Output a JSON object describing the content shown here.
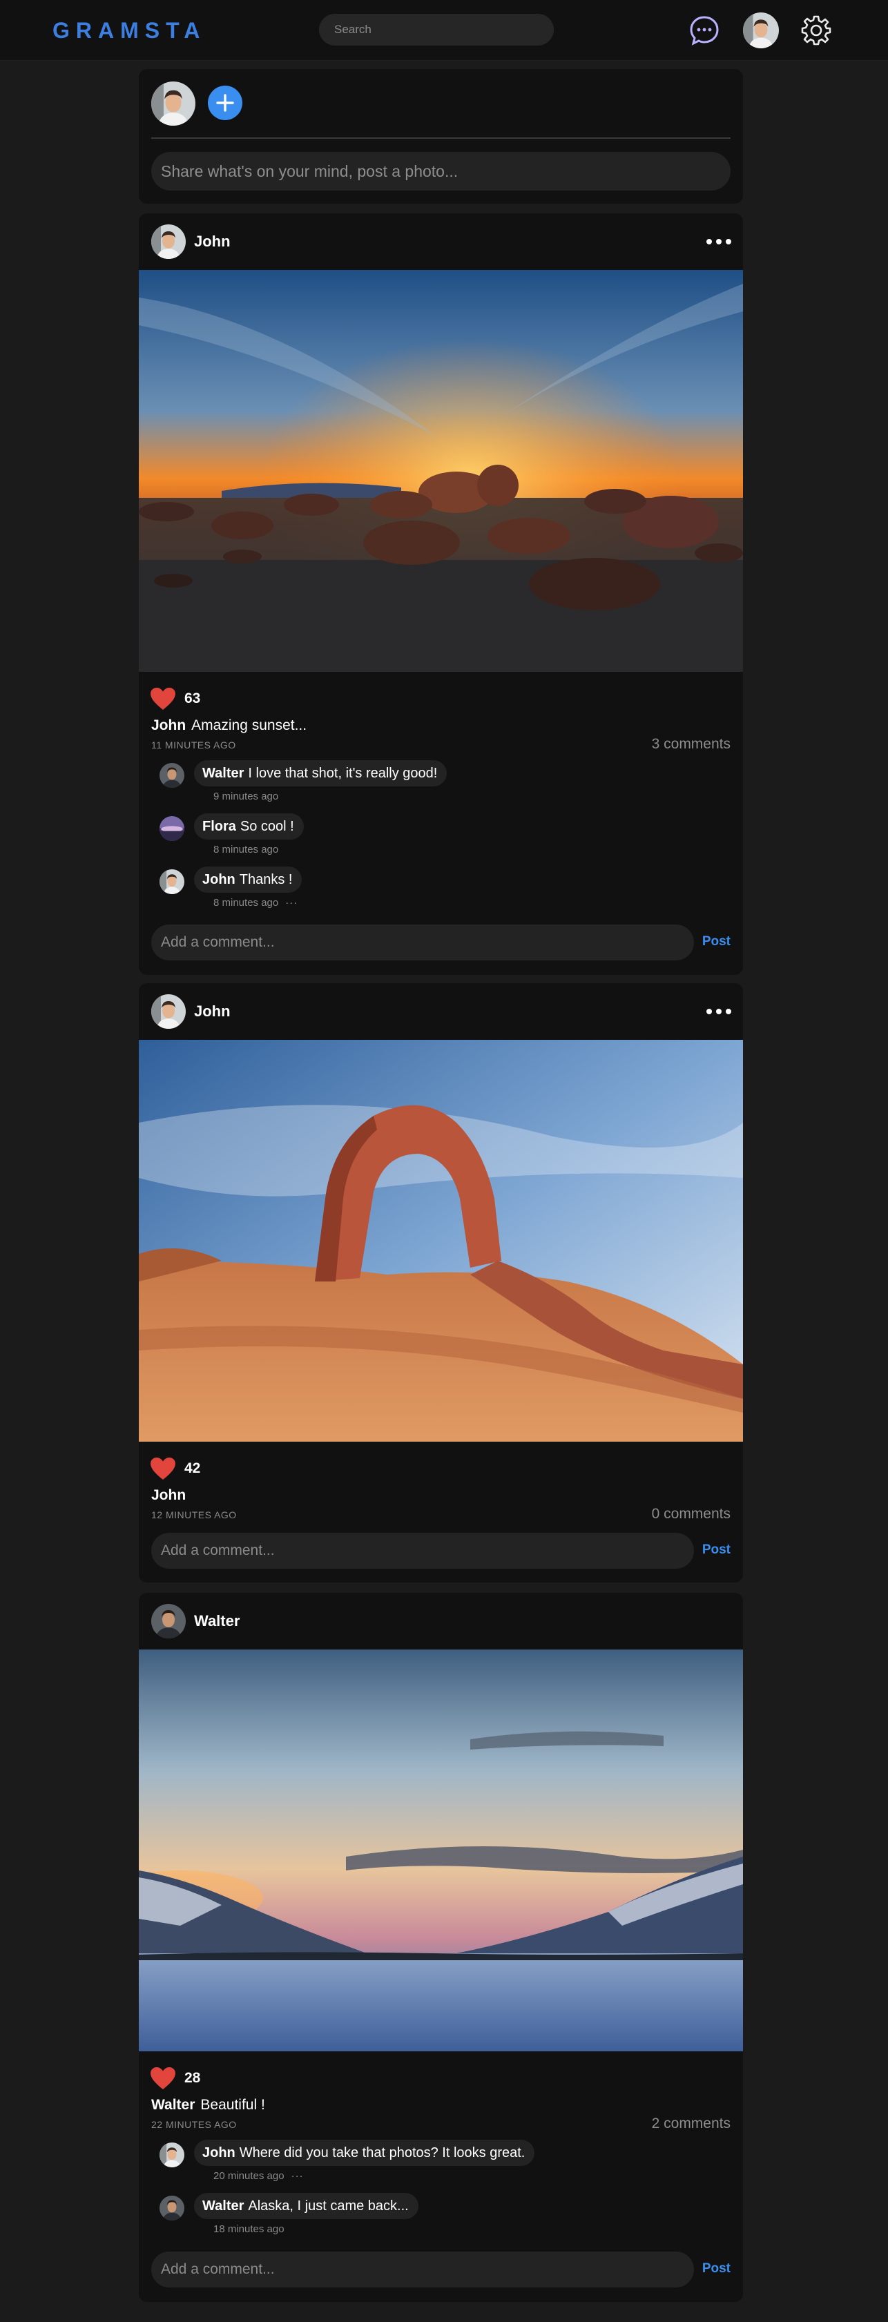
{
  "app": {
    "logo": "GRAMSTA"
  },
  "header": {
    "search_placeholder": "Search"
  },
  "composer": {
    "placeholder": "Share what's on your mind, post a photo..."
  },
  "colors": {
    "accent": "#3a8ef0",
    "logo": "#3d7fe0",
    "heart": "#e2453c",
    "background": "#1b1b1c",
    "card": "#111112"
  },
  "icons": [
    "message-icon",
    "gear-icon",
    "plus-icon",
    "heart-icon",
    "more-icon"
  ],
  "posts": [
    {
      "author": "John",
      "likes": "63",
      "caption_author": "John",
      "caption": "Amazing sunset...",
      "time": "11 MINUTES AGO",
      "comment_count": "3 comments",
      "comments": [
        {
          "author": "Walter",
          "text": "I love that shot, it's really good!",
          "time": "9 minutes ago"
        },
        {
          "author": "Flora",
          "text": "So cool !",
          "time": "8 minutes ago"
        },
        {
          "author": "John",
          "text": "Thanks !",
          "time": "8 minutes ago",
          "dots": "···"
        }
      ],
      "add_comment_placeholder": "Add a comment...",
      "post_label": "Post"
    },
    {
      "author": "John",
      "likes": "42",
      "caption_author": "John",
      "caption": "",
      "time": "12 MINUTES AGO",
      "comment_count": "0 comments",
      "comments": [],
      "add_comment_placeholder": "Add a comment...",
      "post_label": "Post"
    },
    {
      "author": "Walter",
      "likes": "28",
      "caption_author": "Walter",
      "caption": "Beautiful !",
      "time": "22 MINUTES AGO",
      "comment_count": "2 comments",
      "comments": [
        {
          "author": "John",
          "text": "Where did you take that photos? It looks great.",
          "time": "20 minutes ago",
          "dots": "···"
        },
        {
          "author": "Walter",
          "text": "Alaska, I just came back...",
          "time": "18 minutes ago"
        }
      ],
      "add_comment_placeholder": "Add a comment...",
      "post_label": "Post"
    }
  ]
}
